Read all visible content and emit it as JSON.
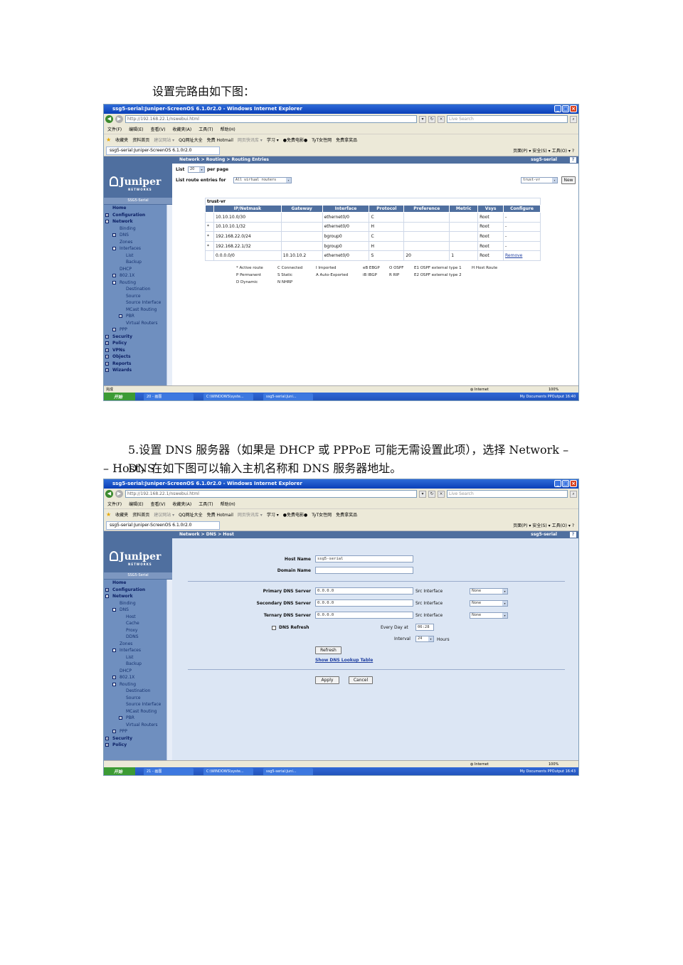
{
  "doc": {
    "caption1": "设置完路由如下图：",
    "para2_line1": "5.设置 DNS 服务器（如果是 DHCP 或 PPPoE 可能无需设置此项），选择 Network – DNS",
    "para2_line2": "– Host，在如下图可以输入主机名称和 DNS 服务器地址。"
  },
  "browser": {
    "window_title": "ssg5-serial:Juniper-ScreenOS 6.1.0r2.0 - Windows Internet Explorer",
    "address1": "http://192.168.22.1/nswebui.html",
    "address2": "http://192.168.22.1/nswebui.html",
    "search_placeholder": "Live Search",
    "menu": [
      "文件(F)",
      "编辑(E)",
      "查看(V)",
      "收藏夹(A)",
      "工具(T)",
      "帮助(H)"
    ],
    "favorites": [
      "收藏夹",
      "资料首页",
      "建议网站 ▾",
      "QQ网址大全",
      "免费 Hotmail",
      "网页快讯库 ▾",
      "学习 ▾",
      "●免费电影●",
      "TyT女性网",
      "免费拿奖品"
    ],
    "tab_title": "ssg5-serial:Juniper-ScreenOS 6.1.0r2.0",
    "tools": "页面(P) ▾   安全(S) ▾   工具(O) ▾   ?",
    "status_text": "完成",
    "status_zone": "Internet",
    "status_zoom": "100%"
  },
  "taskbar": {
    "start": "开始",
    "tasks1": [
      "20 - 画图",
      "C:\\WINDOWS\\syste...",
      "ssg5-serial:Juni..."
    ],
    "tasks2": [
      "21 - 画图",
      "C:\\WINDOWS\\syste...",
      "ssg5-serial:Juni..."
    ],
    "tray1": "My Documents  PPOutput   16:40",
    "tray2": "My Documents  PPOutput   16:43"
  },
  "sidebar": {
    "logo": "Juniper",
    "logo_sub": "NETWORKS",
    "device": "SSG5-Serial",
    "tree1": [
      {
        "label": "Home",
        "level": 0,
        "pm": ""
      },
      {
        "label": "Configuration",
        "level": 0,
        "pm": "+"
      },
      {
        "label": "Network",
        "level": 0,
        "pm": "-"
      },
      {
        "label": "Binding",
        "level": 1,
        "pm": ""
      },
      {
        "label": "DNS",
        "level": 1,
        "pm": "+"
      },
      {
        "label": "Zones",
        "level": 1,
        "pm": ""
      },
      {
        "label": "Interfaces",
        "level": 1,
        "pm": "-"
      },
      {
        "label": "List",
        "level": 2,
        "pm": ""
      },
      {
        "label": "Backup",
        "level": 2,
        "pm": ""
      },
      {
        "label": "DHCP",
        "level": 1,
        "pm": ""
      },
      {
        "label": "802.1X",
        "level": 1,
        "pm": "+"
      },
      {
        "label": "Routing",
        "level": 1,
        "pm": "-"
      },
      {
        "label": "Destination",
        "level": 2,
        "pm": ""
      },
      {
        "label": "Source",
        "level": 2,
        "pm": ""
      },
      {
        "label": "Source Interface",
        "level": 2,
        "pm": ""
      },
      {
        "label": "MCast Routing",
        "level": 2,
        "pm": ""
      },
      {
        "label": "PBR",
        "level": 2,
        "pm": "+"
      },
      {
        "label": "Virtual Routers",
        "level": 2,
        "pm": ""
      },
      {
        "label": "PPP",
        "level": 1,
        "pm": "+"
      },
      {
        "label": "Security",
        "level": 0,
        "pm": "+"
      },
      {
        "label": "Policy",
        "level": 0,
        "pm": "+"
      },
      {
        "label": "VPNs",
        "level": 0,
        "pm": "+"
      },
      {
        "label": "Objects",
        "level": 0,
        "pm": "+"
      },
      {
        "label": "Reports",
        "level": 0,
        "pm": "+"
      },
      {
        "label": "Wizards",
        "level": 0,
        "pm": "+"
      }
    ],
    "tree2": [
      {
        "label": "Home",
        "level": 0,
        "pm": ""
      },
      {
        "label": "Configuration",
        "level": 0,
        "pm": "+"
      },
      {
        "label": "Network",
        "level": 0,
        "pm": "-"
      },
      {
        "label": "Binding",
        "level": 1,
        "pm": ""
      },
      {
        "label": "DNS",
        "level": 1,
        "pm": "-"
      },
      {
        "label": "Host",
        "level": 2,
        "pm": ""
      },
      {
        "label": "Cache",
        "level": 2,
        "pm": ""
      },
      {
        "label": "Proxy",
        "level": 2,
        "pm": ""
      },
      {
        "label": "DDNS",
        "level": 2,
        "pm": ""
      },
      {
        "label": "Zones",
        "level": 1,
        "pm": ""
      },
      {
        "label": "Interfaces",
        "level": 1,
        "pm": "-"
      },
      {
        "label": "List",
        "level": 2,
        "pm": ""
      },
      {
        "label": "Backup",
        "level": 2,
        "pm": ""
      },
      {
        "label": "DHCP",
        "level": 1,
        "pm": ""
      },
      {
        "label": "802.1X",
        "level": 1,
        "pm": "+"
      },
      {
        "label": "Routing",
        "level": 1,
        "pm": "-"
      },
      {
        "label": "Destination",
        "level": 2,
        "pm": ""
      },
      {
        "label": "Source",
        "level": 2,
        "pm": ""
      },
      {
        "label": "Source Interface",
        "level": 2,
        "pm": ""
      },
      {
        "label": "MCast Routing",
        "level": 2,
        "pm": ""
      },
      {
        "label": "PBR",
        "level": 2,
        "pm": "+"
      },
      {
        "label": "Virtual Routers",
        "level": 2,
        "pm": ""
      },
      {
        "label": "PPP",
        "level": 1,
        "pm": "+"
      },
      {
        "label": "Security",
        "level": 0,
        "pm": "+"
      },
      {
        "label": "Policy",
        "level": 0,
        "pm": "+"
      }
    ]
  },
  "routing": {
    "breadcrumb": "Network > Routing > Routing Entries",
    "device": "ssg5-serial",
    "help": "?",
    "list_label": "List",
    "list_count": "20",
    "per_page": "per page",
    "list_for_label": "List route entries for",
    "list_for_value": "All virtual routers",
    "vr_select": "trust-vr",
    "new_button": "New",
    "table_title": "trust-vr",
    "columns": [
      "",
      "IP/Netmask",
      "Gateway",
      "Interface",
      "Protocol",
      "Preference",
      "Metric",
      "Vsys",
      "Configure"
    ],
    "rows": [
      [
        "",
        "10.10.10.0/30",
        "",
        "ethernet0/0",
        "C",
        "",
        "",
        "Root",
        "-"
      ],
      [
        "*",
        "10.10.10.1/32",
        "",
        "ethernet0/0",
        "H",
        "",
        "",
        "Root",
        "-"
      ],
      [
        "*",
        "192.168.22.0/24",
        "",
        "bgroup0",
        "C",
        "",
        "",
        "Root",
        "-"
      ],
      [
        "*",
        "192.168.22.1/32",
        "",
        "bgroup0",
        "H",
        "",
        "",
        "Root",
        "-"
      ],
      [
        "",
        "0.0.0.0/0",
        "10.10.10.2",
        "ethernet0/0",
        "S",
        "20",
        "1",
        "Root",
        "Remove"
      ]
    ],
    "legend_row1": [
      "* Active route",
      "C Connected",
      "I Imported",
      "eB EBGP",
      "O OSPF",
      "E1 OSPF external type 1",
      "H Host Route"
    ],
    "legend_row2": [
      "P Permanent",
      "S Static",
      "A Auto-Exported",
      "iB IBGP",
      "R RIP",
      "E2 OSPF external type 2"
    ],
    "legend_row3": [
      "D Dynamic",
      "N NHRP"
    ]
  },
  "dns": {
    "breadcrumb": "Network > DNS > Host",
    "device": "ssg5-serial",
    "help": "?",
    "host_name_label": "Host Name",
    "host_name_value": "ssg5-serial",
    "domain_name_label": "Domain Name",
    "domain_name_value": "",
    "primary_label": "Primary DNS Server",
    "primary_value": "0.0.0.0",
    "secondary_label": "Secondary DNS Server",
    "secondary_value": "0.0.0.0",
    "tertiary_label": "Ternary DNS Server",
    "tertiary_value": "0.0.0.0",
    "src_interface_label": "Src Interface",
    "src_primary": "None",
    "src_secondary": "None",
    "src_tertiary": "None",
    "dns_refresh_label": "DNS Refresh",
    "every_day_label": "Every Day at",
    "every_day_value": "06:28",
    "interval_label": "Interval",
    "interval_value": "24",
    "hours_label": "Hours",
    "refresh_button": "Refresh",
    "lookup_link": "Show DNS Lookup Table",
    "apply_button": "Apply",
    "cancel_button": "Cancel"
  }
}
